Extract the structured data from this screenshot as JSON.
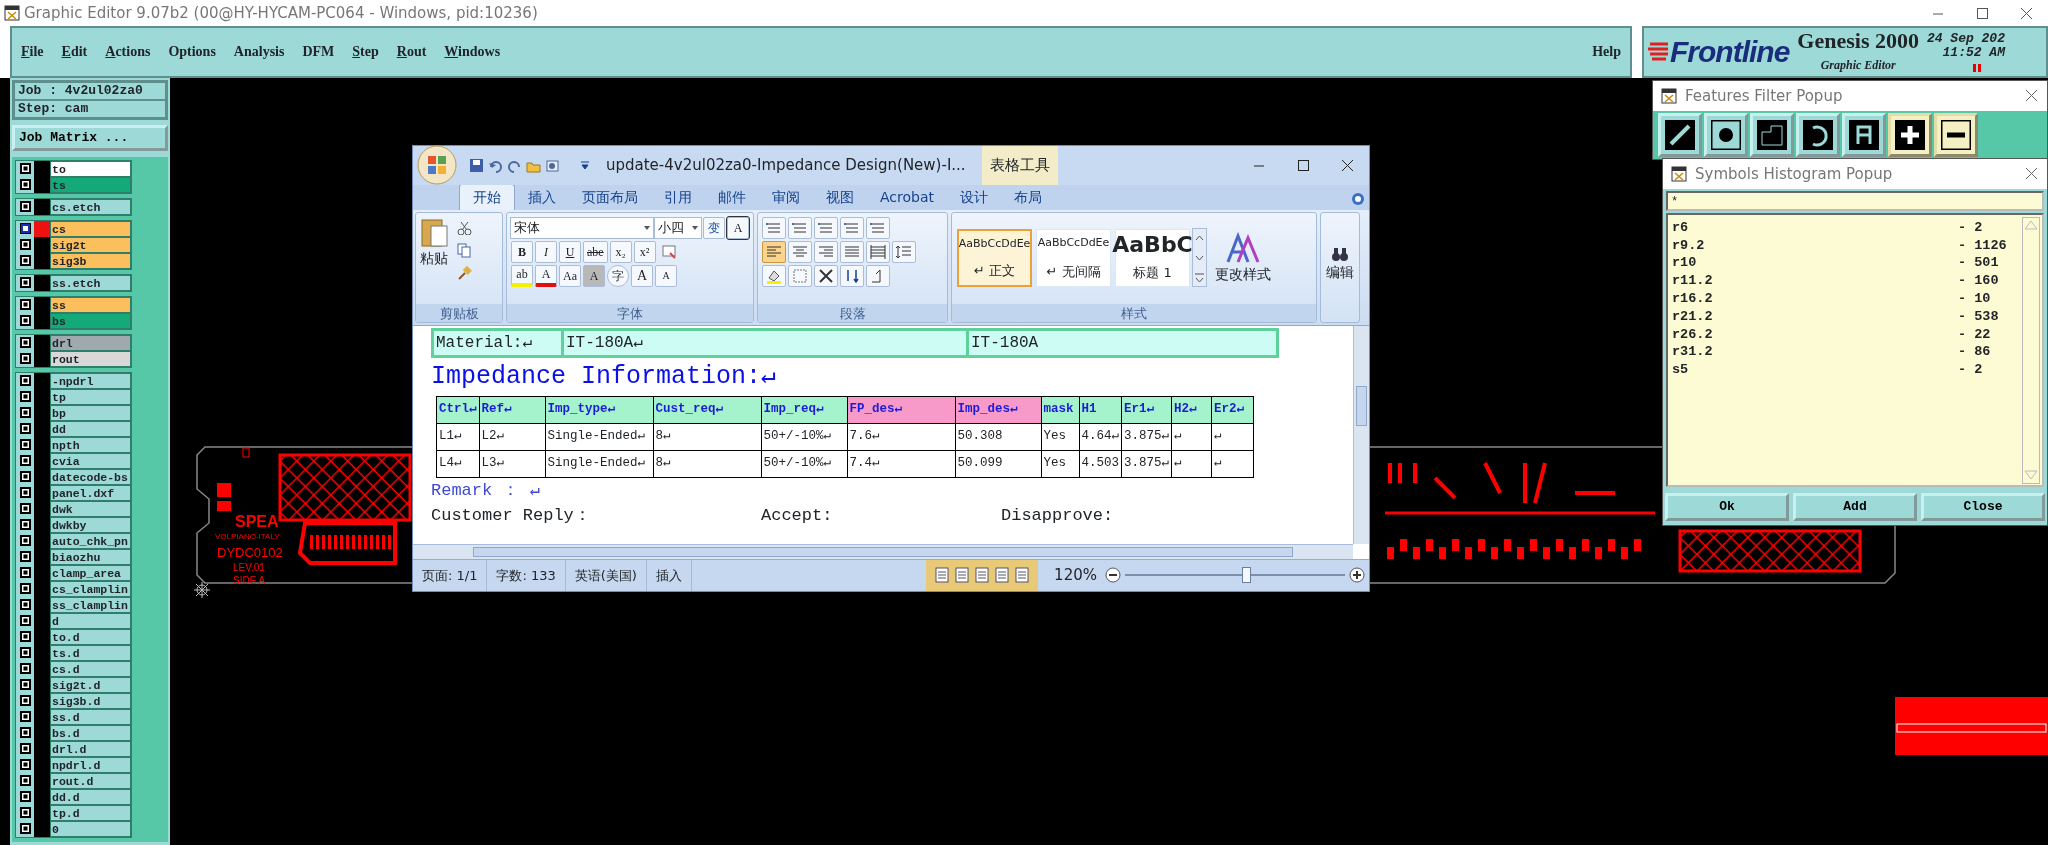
{
  "window": {
    "title": "Graphic Editor 9.07b2 (00@HY-HYCAM-PC064 - Windows, pid:10236)"
  },
  "menu": [
    {
      "label": "File",
      "underlined": true
    },
    {
      "label": "Edit",
      "underlined": true
    },
    {
      "label": "Actions",
      "underlined": true
    },
    {
      "label": "Options",
      "underlined": false
    },
    {
      "label": "Analysis",
      "underlined": false
    },
    {
      "label": "DFM",
      "underlined": false
    },
    {
      "label": "Step",
      "underlined": true
    },
    {
      "label": "Rout",
      "underlined": true
    },
    {
      "label": "Windows",
      "underlined": true
    }
  ],
  "help": "Help",
  "header": {
    "brand": "Frontline",
    "product": "Genesis 2000",
    "subtitle": "Graphic Editor",
    "date": "24 Sep 202",
    "time": "11:52 AM"
  },
  "job": {
    "job": "Job : 4v2ul02za0",
    "step": "Step: cam",
    "matrix_button": "Job Matrix ..."
  },
  "layer_groups": [
    {
      "layers": [
        {
          "name": "to",
          "color": "#ffffff",
          "work": false
        },
        {
          "name": "ts",
          "color": "#13a978",
          "work": false
        }
      ]
    },
    {
      "layers": [
        {
          "name": "cs.etch",
          "color": "#9dd9d7",
          "work": false
        }
      ]
    },
    {
      "layers": [
        {
          "name": "cs",
          "color": "#fbbf5e",
          "work": true
        },
        {
          "name": "sig2t",
          "color": "#fbbf5e",
          "work": false
        },
        {
          "name": "sig3b",
          "color": "#fbbf5e",
          "work": false
        }
      ]
    },
    {
      "layers": [
        {
          "name": "ss.etch",
          "color": "#9dd9d7",
          "work": false
        }
      ]
    },
    {
      "layers": [
        {
          "name": "ss",
          "color": "#fbbf5e",
          "work": false
        },
        {
          "name": "bs",
          "color": "#13a978",
          "work": false
        }
      ]
    },
    {
      "layers": [
        {
          "name": "drl",
          "color": "#9eaab0",
          "work": false
        },
        {
          "name": "rout",
          "color": "#d8d8d8",
          "work": false
        }
      ]
    },
    {
      "layers": [
        {
          "name": "-npdrl",
          "color": "#9dd9d7",
          "work": false
        },
        {
          "name": "tp",
          "color": "#9dd9d7",
          "work": false
        },
        {
          "name": "bp",
          "color": "#9dd9d7",
          "work": false
        },
        {
          "name": "dd",
          "color": "#9dd9d7",
          "work": false
        },
        {
          "name": "npth",
          "color": "#9dd9d7",
          "work": false
        },
        {
          "name": "cvia",
          "color": "#9dd9d7",
          "work": false
        },
        {
          "name": "datecode-bs",
          "color": "#9dd9d7",
          "work": false
        },
        {
          "name": "panel.dxf",
          "color": "#9dd9d7",
          "work": false
        },
        {
          "name": "dwk",
          "color": "#9dd9d7",
          "work": false
        },
        {
          "name": "dwkby",
          "color": "#9dd9d7",
          "work": false
        },
        {
          "name": "auto_chk_pn",
          "color": "#9dd9d7",
          "work": false
        },
        {
          "name": "biaozhu",
          "color": "#9dd9d7",
          "work": false
        },
        {
          "name": "clamp_area",
          "color": "#9dd9d7",
          "work": false
        },
        {
          "name": "cs_clamplin",
          "color": "#9dd9d7",
          "work": false
        },
        {
          "name": "ss_clamplin",
          "color": "#9dd9d7",
          "work": false
        },
        {
          "name": "d",
          "color": "#9dd9d7",
          "work": false
        },
        {
          "name": "to.d",
          "color": "#9dd9d7",
          "work": false
        },
        {
          "name": "ts.d",
          "color": "#9dd9d7",
          "work": false
        },
        {
          "name": "cs.d",
          "color": "#9dd9d7",
          "work": false
        },
        {
          "name": "sig2t.d",
          "color": "#9dd9d7",
          "work": false
        },
        {
          "name": "sig3b.d",
          "color": "#9dd9d7",
          "work": false
        },
        {
          "name": "ss.d",
          "color": "#9dd9d7",
          "work": false
        },
        {
          "name": "bs.d",
          "color": "#9dd9d7",
          "work": false
        },
        {
          "name": "drl.d",
          "color": "#9dd9d7",
          "work": false
        },
        {
          "name": "npdrl.d",
          "color": "#9dd9d7",
          "work": false
        },
        {
          "name": "rout.d",
          "color": "#9dd9d7",
          "work": false
        },
        {
          "name": "dd.d",
          "color": "#9dd9d7",
          "work": false
        },
        {
          "name": "tp.d",
          "color": "#9dd9d7",
          "work": false
        },
        {
          "name": "0",
          "color": "#9dd9d7",
          "work": false
        }
      ]
    }
  ],
  "board": {
    "labels": [
      "SPEA",
      "VOLPIANO-ITALY",
      "DYDC0102",
      "LEV.01",
      "SIDE A"
    ]
  },
  "word": {
    "title": "update-4v2ul02za0-Impedance Design(New)-I...",
    "context_tab": "表格工具",
    "tabs": [
      {
        "label": "开始",
        "selected": true
      },
      {
        "label": "插入",
        "selected": false
      },
      {
        "label": "页面布局",
        "selected": false
      },
      {
        "label": "引用",
        "selected": false
      },
      {
        "label": "邮件",
        "selected": false
      },
      {
        "label": "审阅",
        "selected": false
      },
      {
        "label": "视图",
        "selected": false
      },
      {
        "label": "Acrobat",
        "selected": false
      },
      {
        "label": "设计",
        "selected": false
      },
      {
        "label": "布局",
        "selected": false
      }
    ],
    "paste": "粘贴",
    "font": "宋体",
    "size": "小四",
    "font_row1": [
      {
        "text": "变",
        "kind": "phonetic"
      },
      {
        "text": "A",
        "kind": "border"
      }
    ],
    "font_row2": [
      "B",
      "I",
      "U",
      "abe",
      "x₂",
      "x²"
    ],
    "font_row3": [
      {
        "text": "ab",
        "kind": "highlight"
      },
      {
        "text": "A",
        "kind": "font-color"
      },
      {
        "text": "Aa",
        "kind": "case"
      },
      {
        "text": "A",
        "kind": "shade"
      },
      {
        "text": "字",
        "kind": "enclose"
      },
      {
        "text": "A",
        "kind": "grow"
      },
      {
        "text": "A",
        "kind": "shrink"
      }
    ],
    "align_buttons": [
      {
        "kind": "left",
        "selected": true
      },
      {
        "kind": "center",
        "selected": false
      },
      {
        "kind": "right",
        "selected": false
      },
      {
        "kind": "justify",
        "selected": false
      },
      {
        "kind": "distribute",
        "selected": false
      }
    ],
    "styles": [
      {
        "sample": "AaBbCcDdEe",
        "name": "↵ 正文",
        "kind": "small",
        "selected": true
      },
      {
        "sample": "AaBbCcDdEe",
        "name": "↵ 无间隔",
        "kind": "small",
        "selected": false
      },
      {
        "sample": "AaBbC",
        "name": "标题 1",
        "kind": "large",
        "selected": false
      }
    ],
    "change_styles": "更改样式",
    "edit": "编辑",
    "groups": [
      "剪贴板",
      "字体",
      "段落",
      "样式"
    ],
    "material": [
      "Material:↵",
      "IT-180A↵",
      "IT-180A"
    ],
    "heading": "Impedance Information:↵",
    "columns": [
      {
        "label": "Ctrl↵",
        "color": "#a5f3cc"
      },
      {
        "label": "Ref↵",
        "color": "#a5f3cc"
      },
      {
        "label": "Imp_type↵",
        "color": "#a5f3cc"
      },
      {
        "label": "Cust_req↵",
        "color": "#a5f3cc"
      },
      {
        "label": "Imp_req↵",
        "color": "#a5f3cc"
      },
      {
        "label": "FP_des↵",
        "color": "#f79ac9"
      },
      {
        "label": "Imp_des↵",
        "color": "#f79ac9"
      },
      {
        "label": "mask",
        "color": "#a5f3cc"
      },
      {
        "label": "H1",
        "color": "#a5f3cc"
      },
      {
        "label": "Er1↵",
        "color": "#a5f3cc"
      },
      {
        "label": "H2↵",
        "color": "#a5f3cc"
      },
      {
        "label": "Er2↵",
        "color": "#a5f3cc"
      }
    ],
    "rows": [
      [
        "L1↵",
        "L2↵",
        "Single-Ended↵",
        "8↵",
        "50+/-10%↵",
        "7.6↵",
        "50.308",
        "Yes",
        "4.64↵",
        "3.875↵",
        "↵",
        "↵"
      ],
      [
        "L4↵",
        "L3↵",
        "Single-Ended↵",
        "8↵",
        "50+/-10%↵",
        "7.4↵",
        "50.099",
        "Yes",
        "4.503",
        "3.875↵",
        "↵",
        "↵"
      ]
    ],
    "remark": "Remark ： ↵",
    "reply": [
      "Customer Reply：",
      "Accept:",
      "Disapprove:"
    ],
    "status": [
      "页面: 1/1",
      "字数: 133",
      "英语(美国)",
      "插入"
    ],
    "zoom": {
      "label": "120%",
      "level": 0.55
    }
  },
  "features_filter": {
    "title": "Features Filter Popup",
    "buttons": [
      {
        "kind": "line"
      },
      {
        "kind": "pad"
      },
      {
        "kind": "surface"
      },
      {
        "kind": "arc"
      },
      {
        "kind": "text"
      },
      {
        "kind": "positive"
      },
      {
        "kind": "negative"
      }
    ]
  },
  "histogram": {
    "title": "Symbols Histogram Popup",
    "filter": "*",
    "rows": [
      {
        "symbol": "r6",
        "count": "- 2"
      },
      {
        "symbol": "r9.2",
        "count": "- 1126"
      },
      {
        "symbol": "r10",
        "count": "- 501"
      },
      {
        "symbol": "r11.2",
        "count": "- 160"
      },
      {
        "symbol": "r16.2",
        "count": "- 10"
      },
      {
        "symbol": "r21.2",
        "count": "- 538"
      },
      {
        "symbol": "r26.2",
        "count": "- 22"
      },
      {
        "symbol": "r31.2",
        "count": "- 86"
      },
      {
        "symbol": "s5",
        "count": "- 2"
      }
    ],
    "buttons": [
      "Ok",
      "Add",
      "Close"
    ]
  }
}
